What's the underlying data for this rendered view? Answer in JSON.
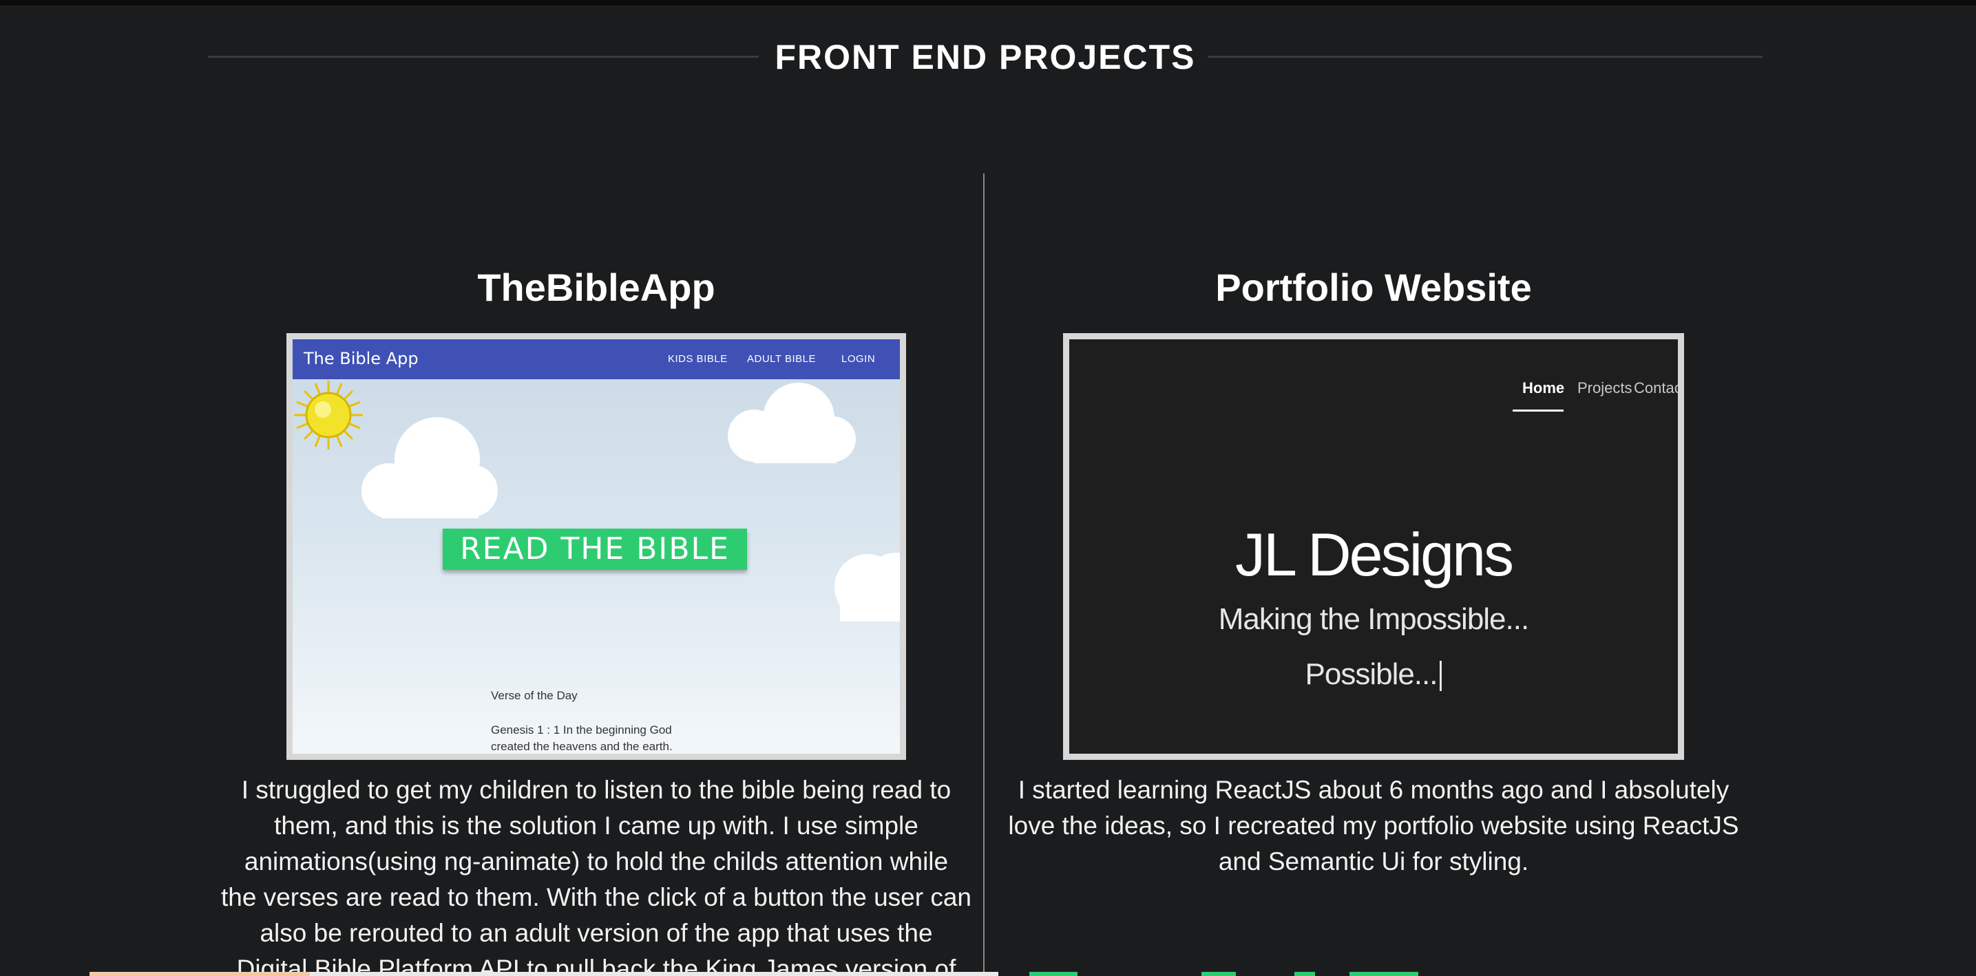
{
  "section": {
    "title": "FRONT END PROJECTS"
  },
  "projects": [
    {
      "title": "TheBibleApp",
      "description_lines": [
        "I struggled to get my children to listen to the bible being read to",
        "them, and this is the solution I came up with. I use simple",
        "animations(using ng-animate) to hold the childs attention while",
        "the verses are read to them. With the click of a button the user can",
        "also be rerouted to an adult version of the app that uses the",
        "Digital Bible Platform API to pull back the King James version of"
      ],
      "screenshot": {
        "brand": "The Bible App",
        "nav": [
          "KIDS BIBLE",
          "ADULT BIBLE",
          "LOGIN"
        ],
        "button": "READ THE BIBLE",
        "verse_label": "Verse of the Day",
        "verse_text": "Genesis 1 : 1 In the beginning God created the heavens and the earth.",
        "colors": {
          "nav": "#3f51b5",
          "button": "#2ecc71"
        }
      }
    },
    {
      "title": "Portfolio Website",
      "description_lines": [
        "I started learning ReactJS about 6 months ago and I absolutely",
        "love the ideas, so I recreated my portfolio website using ReactJS",
        "and Semantic Ui for styling."
      ],
      "screenshot": {
        "nav": [
          "Home",
          "Projects",
          "Contact"
        ],
        "active_nav": "Home",
        "title": "JL Designs",
        "line1": "Making the Impossible...",
        "line2": "Possible..."
      }
    }
  ]
}
